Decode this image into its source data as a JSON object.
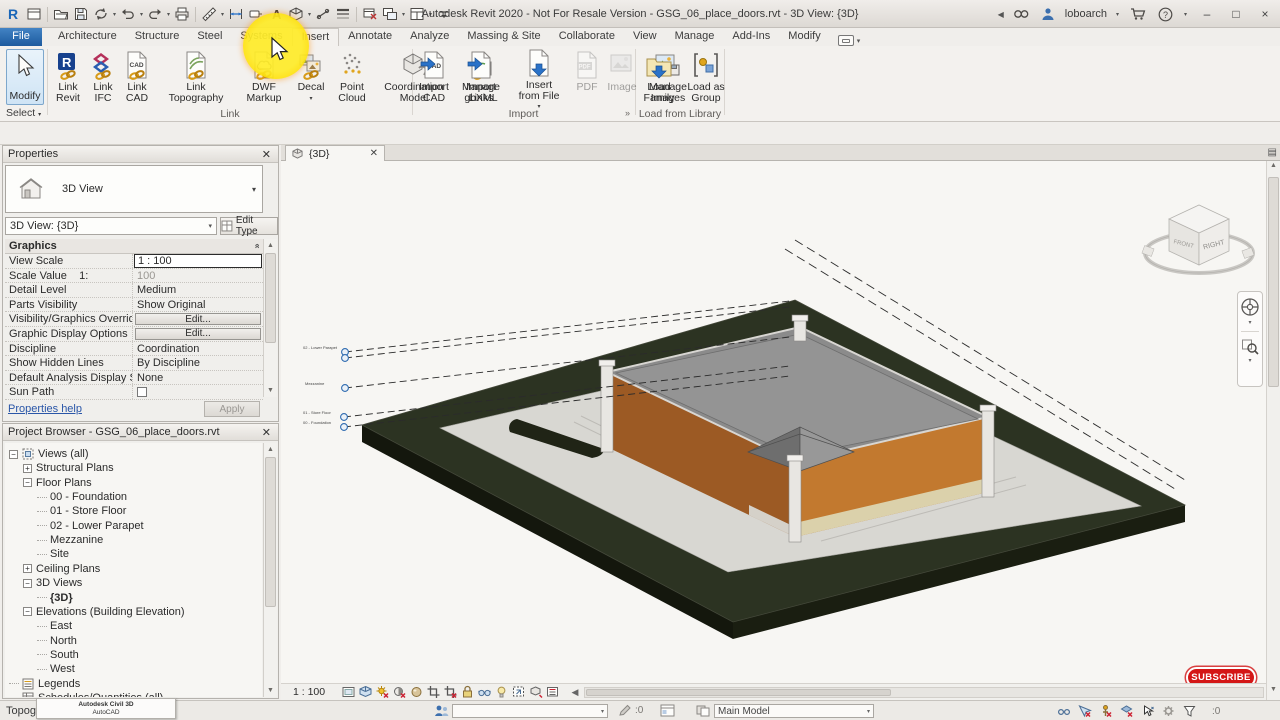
{
  "title_bar": {
    "app_title": "Autodesk Revit 2020 - Not For Resale Version - GSG_06_place_doors.rvt - 3D View: {3D}",
    "username": "loboarch"
  },
  "qat_icons": [
    "revit-logo",
    "file-window",
    "open",
    "save",
    "sync",
    "undo",
    "redo",
    "print",
    "measure",
    "aligned-dimension",
    "tag",
    "text",
    "default-3d-view",
    "section",
    "thin-lines",
    "close-hidden-windows",
    "switch-windows",
    "user-interface",
    "customize-qat"
  ],
  "ribbon_tabs": [
    "File",
    "Architecture",
    "Structure",
    "Steel",
    "Systems",
    "Insert",
    "Annotate",
    "Analyze",
    "Massing & Site",
    "Collaborate",
    "View",
    "Manage",
    "Add-Ins",
    "Modify"
  ],
  "active_tab": "Insert",
  "select_panel": {
    "modify": "Modify",
    "select": "Select"
  },
  "ribbon_panels": [
    {
      "label": "Link",
      "launcher": false,
      "buttons": [
        {
          "name": "link-revit",
          "lines": [
            "Link",
            "Revit"
          ]
        },
        {
          "name": "link-ifc",
          "lines": [
            "Link",
            "IFC"
          ]
        },
        {
          "name": "link-cad",
          "lines": [
            "Link",
            "CAD"
          ]
        },
        {
          "name": "link-topography",
          "lines": [
            "Link",
            "Topography"
          ]
        },
        {
          "name": "dwf-markup",
          "lines": [
            "DWF",
            "Markup"
          ]
        },
        {
          "name": "decal",
          "lines": [
            "Decal"
          ],
          "dropdown": true
        },
        {
          "name": "point-cloud",
          "lines": [
            "Point",
            "Cloud"
          ]
        },
        {
          "name": "coordination-model",
          "lines": [
            "Coordination",
            "Model"
          ]
        },
        {
          "name": "manage-links",
          "lines": [
            "Manage",
            "Links"
          ]
        }
      ]
    },
    {
      "label": "Import",
      "launcher": true,
      "buttons": [
        {
          "name": "import-cad",
          "lines": [
            "Import",
            "CAD"
          ]
        },
        {
          "name": "import-gbxml",
          "lines": [
            "Import",
            "gbXML"
          ]
        },
        {
          "name": "insert-from-file",
          "lines": [
            "Insert",
            "from File"
          ],
          "dropdown": true
        },
        {
          "name": "pdf",
          "lines": [
            "PDF"
          ],
          "disabled": true
        },
        {
          "name": "image",
          "lines": [
            "Image"
          ],
          "disabled": true
        },
        {
          "name": "manage-images",
          "lines": [
            "Manage",
            "Images"
          ]
        }
      ]
    },
    {
      "label": "Load from Library",
      "launcher": false,
      "buttons": [
        {
          "name": "load-family",
          "lines": [
            "Load",
            "Family"
          ]
        },
        {
          "name": "load-as-group",
          "lines": [
            "Load as",
            "Group"
          ]
        }
      ]
    }
  ],
  "properties": {
    "title": "Properties",
    "type_label": "3D View",
    "instance_selector": "3D View: {3D}",
    "edit_type": "Edit Type",
    "section": "Graphics",
    "rows": [
      {
        "label": "View Scale",
        "value": "1 : 100",
        "kind": "input"
      },
      {
        "label": "Scale Value    1:",
        "value": "100",
        "kind": "disabled"
      },
      {
        "label": "Detail Level",
        "value": "Medium",
        "kind": "text"
      },
      {
        "label": "Parts Visibility",
        "value": "Show Original",
        "kind": "text"
      },
      {
        "label": "Visibility/Graphics Overrides",
        "value": "Edit...",
        "kind": "button"
      },
      {
        "label": "Graphic Display Options",
        "value": "Edit...",
        "kind": "button"
      },
      {
        "label": "Discipline",
        "value": "Coordination",
        "kind": "text"
      },
      {
        "label": "Show Hidden Lines",
        "value": "By Discipline",
        "kind": "text"
      },
      {
        "label": "Default Analysis Display St...",
        "value": "None",
        "kind": "text"
      },
      {
        "label": "Sun Path",
        "value": "",
        "kind": "checkbox"
      }
    ],
    "help": "Properties help",
    "apply": "Apply"
  },
  "project_browser": {
    "title": "Project Browser - GSG_06_place_doors.rvt",
    "tree": [
      {
        "label": "Views (all)",
        "depth": 0,
        "exp": "minus",
        "icon": "views"
      },
      {
        "label": "Structural Plans",
        "depth": 1,
        "exp": "plus"
      },
      {
        "label": "Floor Plans",
        "depth": 1,
        "exp": "minus"
      },
      {
        "label": "00 - Foundation",
        "depth": 2
      },
      {
        "label": "01 - Store Floor",
        "depth": 2
      },
      {
        "label": "02 - Lower Parapet",
        "depth": 2
      },
      {
        "label": "Mezzanine",
        "depth": 2
      },
      {
        "label": "Site",
        "depth": 2
      },
      {
        "label": "Ceiling Plans",
        "depth": 1,
        "exp": "plus"
      },
      {
        "label": "3D Views",
        "depth": 1,
        "exp": "minus"
      },
      {
        "label": "{3D}",
        "depth": 2,
        "bold": true
      },
      {
        "label": "Elevations (Building Elevation)",
        "depth": 1,
        "exp": "minus"
      },
      {
        "label": "East",
        "depth": 2
      },
      {
        "label": "North",
        "depth": 2
      },
      {
        "label": "South",
        "depth": 2
      },
      {
        "label": "West",
        "depth": 2
      },
      {
        "label": "Legends",
        "depth": 0,
        "icon": "legends"
      },
      {
        "label": "Schedules/Quantities (all)",
        "depth": 0,
        "icon": "schedules"
      }
    ]
  },
  "view_tab": "{3D}",
  "viewcube": {
    "right": "RIGHT",
    "front": "FRONT"
  },
  "levels": [
    {
      "label": "02 - Lower Parapet"
    },
    {
      "label": ""
    },
    {
      "label": "Mezzanine"
    },
    {
      "label": "01 - Store Floor"
    },
    {
      "label": "00 - Foundation"
    }
  ],
  "view_control_bar": {
    "scale": "1 : 100",
    "icons": [
      "detail-level",
      "visual-style",
      "sun-path",
      "shadows",
      "rendering",
      "crop-view",
      "show-crop-region",
      "lock-3d-view",
      "temporary-hide-isolate",
      "reveal-hidden-elements",
      "temporary-view-properties",
      "displaced-elements",
      "reveal-constraints"
    ]
  },
  "status_bar": {
    "prompt": "Topography : Surface",
    "popup": [
      "Autodesk Civil 3D",
      "AutoCAD"
    ],
    "active_workset": "",
    "edit_count": ":0",
    "design_option": "Main Model",
    "filter_count": ":0",
    "right_icons": [
      "editable-only",
      "select-links",
      "select-pinned",
      "select-by-face",
      "drag-on-selection",
      "settings",
      "filter"
    ]
  },
  "overlay": {
    "subscribe": "SUBSCRIBE"
  },
  "colors": {
    "accent_blue": "#2a62a0",
    "highlight_yellow": "#ffe600",
    "highlight_ring": "#e87b1a",
    "subscribe_red": "#d41717",
    "brick_light": "#c2792f",
    "brick_dark": "#9c5a24",
    "roof_gray": "#8b8b8b",
    "topo_dark": "#2c3322",
    "pad_gray": "#d8d7d2",
    "level_blue": "#2f6bb0"
  }
}
